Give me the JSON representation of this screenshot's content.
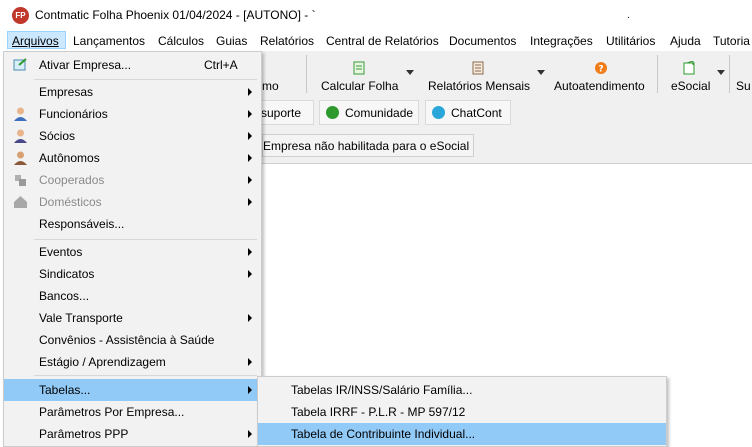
{
  "window": {
    "title": "Contmatic Folha Phoenix 01/04/2024 - [AUTONO] - `",
    "logo_text": "FP",
    "logo_color": "#c0392b",
    "tick": "."
  },
  "menubar": {
    "items": [
      "Arquivos",
      "Lançamentos",
      "Cálculos",
      "Guias",
      "Relatórios",
      "Central de Relatórios",
      "Documentos",
      "Integrações",
      "Utilitários",
      "Ajuda",
      "Tutoria"
    ]
  },
  "toolbar": {
    "partial_label": "mo",
    "calcular_folha": "Calcular Folha",
    "relatorios_mensais": "Relatórios Mensais",
    "autoatendimento": "Autoatendimento",
    "esocial": "eSocial",
    "partial_right": "Su"
  },
  "linkbar": {
    "suporte": "suporte",
    "comunidade": "Comunidade",
    "chatcont": "ChatCont"
  },
  "status": {
    "esocial_message": "Empresa não habilitada para o eSocial"
  },
  "dropdown": {
    "items": [
      {
        "label": "Ativar Empresa...",
        "shortcut": "Ctrl+A"
      },
      {
        "label": "Empresas"
      },
      {
        "label": "Funcionários"
      },
      {
        "label": "Sócios"
      },
      {
        "label": "Autônomos"
      },
      {
        "label": "Cooperados"
      },
      {
        "label": "Domésticos"
      },
      {
        "label": "Responsáveis..."
      },
      {
        "label": "Eventos"
      },
      {
        "label": "Sindicatos"
      },
      {
        "label": "Bancos..."
      },
      {
        "label": "Vale Transporte"
      },
      {
        "label": "Convênios - Assistência à Saúde"
      },
      {
        "label": "Estágio / Aprendizagem"
      },
      {
        "label": "Tabelas..."
      },
      {
        "label": "Parâmetros Por Empresa..."
      },
      {
        "label": "Parâmetros PPP"
      }
    ]
  },
  "submenu": {
    "items": [
      {
        "label": "Tabelas IR/INSS/Salário Família..."
      },
      {
        "label": "Tabela IRRF - P.L.R - MP 597/12"
      },
      {
        "label": "Tabela de Contribuinte Individual..."
      }
    ]
  },
  "colors": {
    "highlight": "#91c9f7",
    "menu_active": "#cce8ff",
    "menu_bg": "#f2f2f2"
  }
}
